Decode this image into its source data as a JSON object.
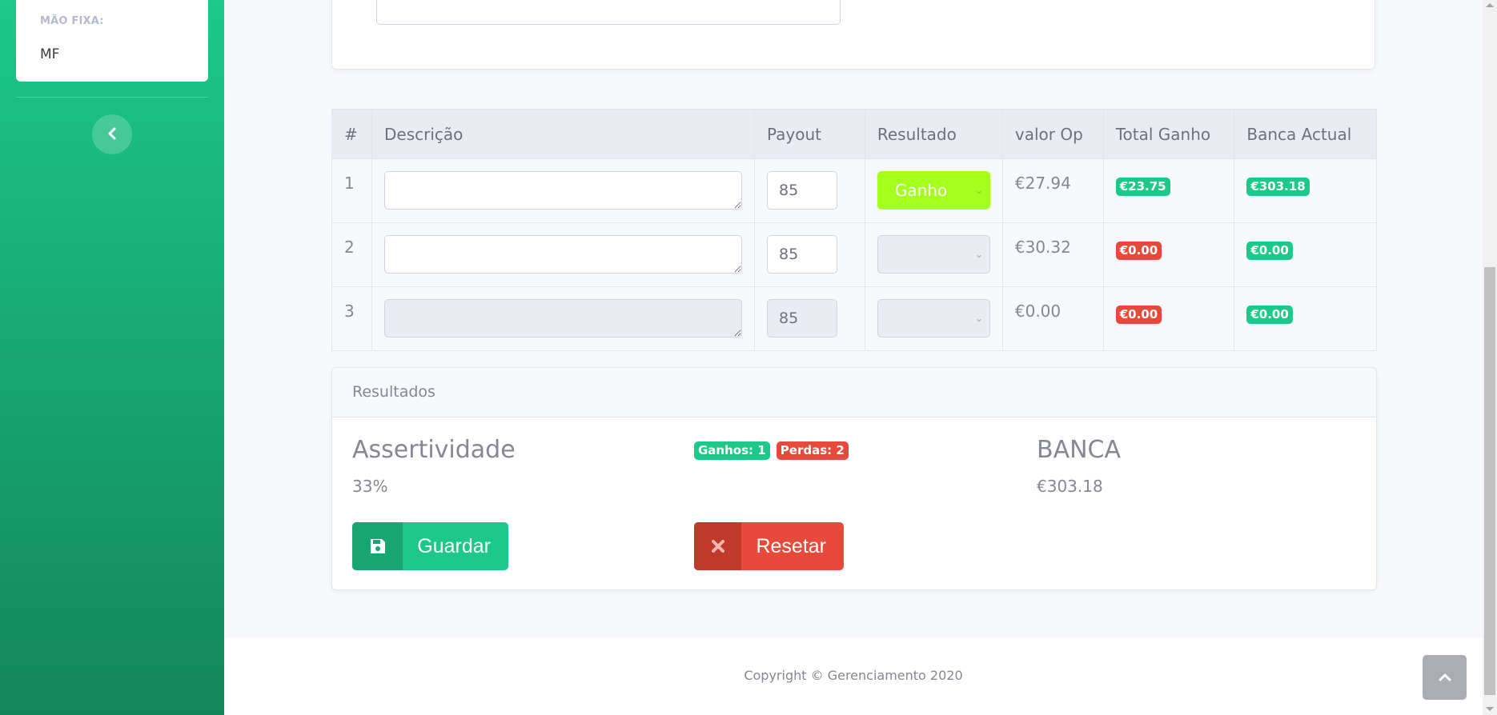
{
  "sidebar": {
    "section_heading": "MÃO FIXA:",
    "item_label": "MF",
    "toggle_icon": "chevron-left-icon"
  },
  "table": {
    "headers": [
      "#",
      "Descrição",
      "Payout",
      "Resultado",
      "valor Op",
      "Total Ganho",
      "Banca Actual"
    ],
    "rows": [
      {
        "num": "1",
        "description": "",
        "payout": "85",
        "result": "Ganho",
        "valor_op": "€27.94",
        "total_ganho": "€23.75",
        "banca_actual": "€303.18"
      },
      {
        "num": "2",
        "description": "",
        "payout": "85",
        "result": "",
        "valor_op": "€30.32",
        "total_ganho": "€0.00",
        "banca_actual": "€0.00"
      },
      {
        "num": "3",
        "description": "",
        "payout": "85",
        "result": "",
        "valor_op": "€0.00",
        "total_ganho": "€0.00",
        "banca_actual": "€0.00"
      }
    ]
  },
  "results": {
    "header": "Resultados",
    "assert_title": "Assertividade",
    "assert_value": "33%",
    "wins_badge": "Ganhos: 1",
    "losses_badge": "Perdas: 2",
    "banca_title": "BANCA",
    "banca_value": "€303.18",
    "save_label": "Guardar",
    "reset_label": "Resetar"
  },
  "footer": {
    "copyright": "Copyright © Gerenciamento 2020"
  },
  "colors": {
    "success": "#1cc88a",
    "danger": "#e74a3b",
    "win_select": "#a4ff1f"
  }
}
